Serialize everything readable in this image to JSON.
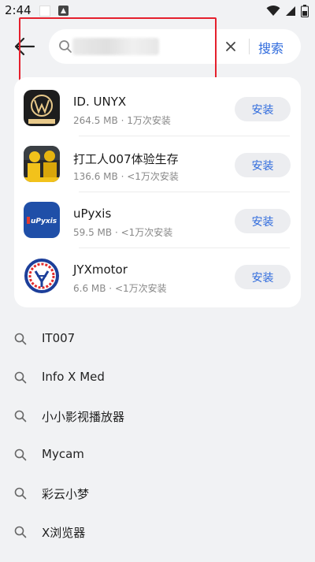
{
  "status_bar": {
    "time": "2:44"
  },
  "search": {
    "clear_label": "×",
    "search_label": "搜索"
  },
  "apps": [
    {
      "name": "ID. UNYX",
      "size": "264.5 MB",
      "installs": "1万次安装",
      "button": "安装",
      "icon": "id-unyx-logo-icon"
    },
    {
      "name": "打工人007体验生存",
      "size": "136.6 MB",
      "installs": "<1万次安装",
      "button": "安装",
      "icon": "worker-game-icon"
    },
    {
      "name": "uPyxis",
      "size": "59.5 MB",
      "installs": "<1万次安装",
      "button": "安装",
      "icon": "upyxis-logo-icon"
    },
    {
      "name": "JYXmotor",
      "size": "6.6 MB",
      "installs": "<1万次安装",
      "button": "安装",
      "icon": "jyxmotor-logo-icon"
    }
  ],
  "history": [
    {
      "label": "IT007"
    },
    {
      "label": "Info X Med"
    },
    {
      "label": "小小影视播放器"
    },
    {
      "label": "Mycam"
    },
    {
      "label": "彩云小梦"
    },
    {
      "label": "X浏览器"
    }
  ],
  "colors": {
    "accent": "#2f6bdd",
    "highlight": "#e5202d",
    "background": "#f1f2f4"
  }
}
